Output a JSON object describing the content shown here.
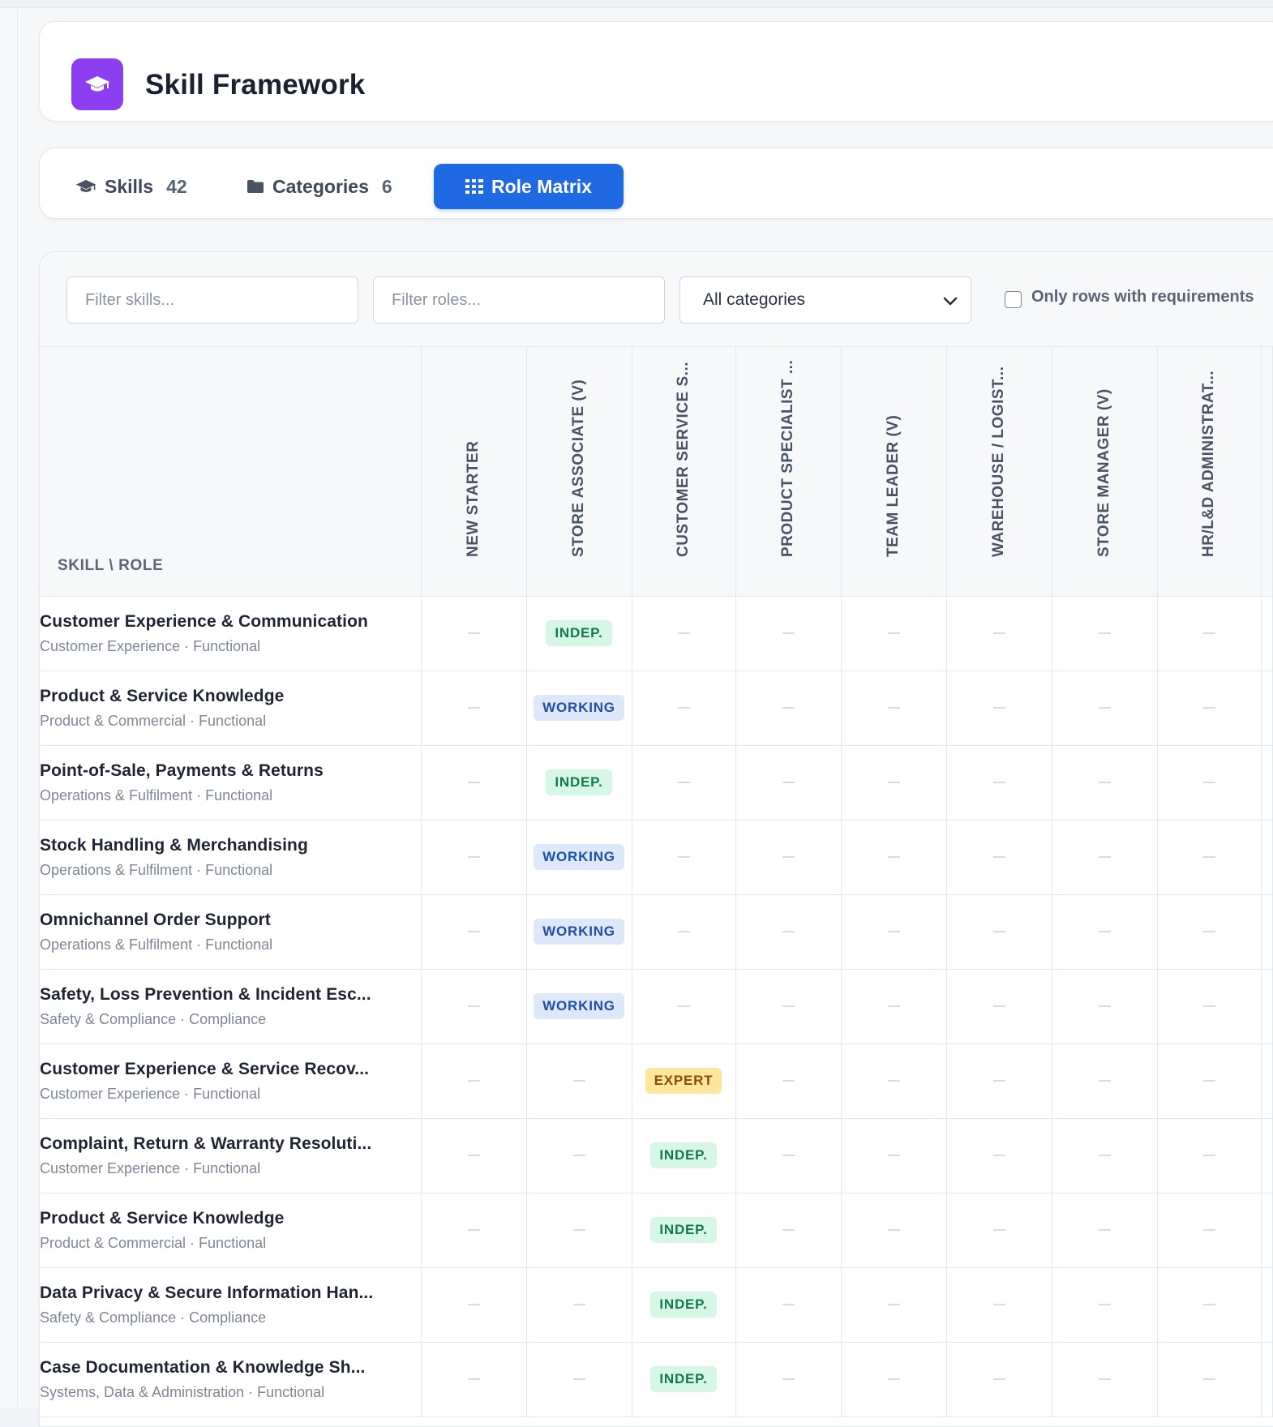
{
  "app": {
    "title": "Skill Framework",
    "icon": "graduation-cap-icon",
    "accent": "#8b3ff1"
  },
  "tabs": {
    "skills": {
      "label": "Skills",
      "count": "42",
      "icon": "graduation-cap-icon"
    },
    "categories": {
      "label": "Categories",
      "count": "6",
      "icon": "folder-icon"
    },
    "matrix": {
      "label": "Role Matrix",
      "icon": "grid-icon",
      "active": true,
      "color": "#1f6ae3"
    }
  },
  "filters": {
    "skills_placeholder": "Filter skills...",
    "roles_placeholder": "Filter roles...",
    "category_selected": "All categories",
    "only_required_label": "Only rows with requirements",
    "only_required_checked": false
  },
  "matrix": {
    "corner_label": "SKILL \\ ROLE",
    "roles": [
      "NEW STARTER",
      "STORE ASSOCIATE (V)",
      "CUSTOMER SERVICE S...",
      "PRODUCT SPECIALIST ...",
      "TEAM LEADER (V)",
      "WAREHOUSE / LOGIST...",
      "STORE MANAGER (V)",
      "HR/L&D ADMINISTRAT..."
    ],
    "empty_marker": "—",
    "level_colors": {
      "INDEP.": "#117a4b",
      "WORKING": "#1f4ea7",
      "EXPERT": "#8d4b08"
    },
    "rows": [
      {
        "name": "Customer Experience & Communication",
        "meta": "Customer Experience · Functional",
        "levels": [
          "",
          "INDEP.",
          "",
          "",
          "",
          "",
          "",
          ""
        ]
      },
      {
        "name": "Product & Service Knowledge",
        "meta": "Product & Commercial · Functional",
        "levels": [
          "",
          "WORKING",
          "",
          "",
          "",
          "",
          "",
          ""
        ]
      },
      {
        "name": "Point-of-Sale, Payments & Returns",
        "meta": "Operations & Fulfilment · Functional",
        "levels": [
          "",
          "INDEP.",
          "",
          "",
          "",
          "",
          "",
          ""
        ]
      },
      {
        "name": "Stock Handling & Merchandising",
        "meta": "Operations & Fulfilment · Functional",
        "levels": [
          "",
          "WORKING",
          "",
          "",
          "",
          "",
          "",
          ""
        ]
      },
      {
        "name": "Omnichannel Order Support",
        "meta": "Operations & Fulfilment · Functional",
        "levels": [
          "",
          "WORKING",
          "",
          "",
          "",
          "",
          "",
          ""
        ]
      },
      {
        "name": "Safety, Loss Prevention & Incident Esc...",
        "meta": "Safety & Compliance · Compliance",
        "levels": [
          "",
          "WORKING",
          "",
          "",
          "",
          "",
          "",
          ""
        ]
      },
      {
        "name": "Customer Experience & Service Recov...",
        "meta": "Customer Experience · Functional",
        "levels": [
          "",
          "",
          "EXPERT",
          "",
          "",
          "",
          "",
          ""
        ]
      },
      {
        "name": "Complaint, Return & Warranty Resoluti...",
        "meta": "Customer Experience · Functional",
        "levels": [
          "",
          "",
          "INDEP.",
          "",
          "",
          "",
          "",
          ""
        ]
      },
      {
        "name": "Product & Service Knowledge",
        "meta": "Product & Commercial · Functional",
        "levels": [
          "",
          "",
          "INDEP.",
          "",
          "",
          "",
          "",
          ""
        ]
      },
      {
        "name": "Data Privacy & Secure Information Han...",
        "meta": "Safety & Compliance · Compliance",
        "levels": [
          "",
          "",
          "INDEP.",
          "",
          "",
          "",
          "",
          ""
        ]
      },
      {
        "name": "Case Documentation & Knowledge Sh...",
        "meta": "Systems, Data & Administration · Functional",
        "levels": [
          "",
          "",
          "INDEP.",
          "",
          "",
          "",
          "",
          ""
        ]
      }
    ]
  }
}
